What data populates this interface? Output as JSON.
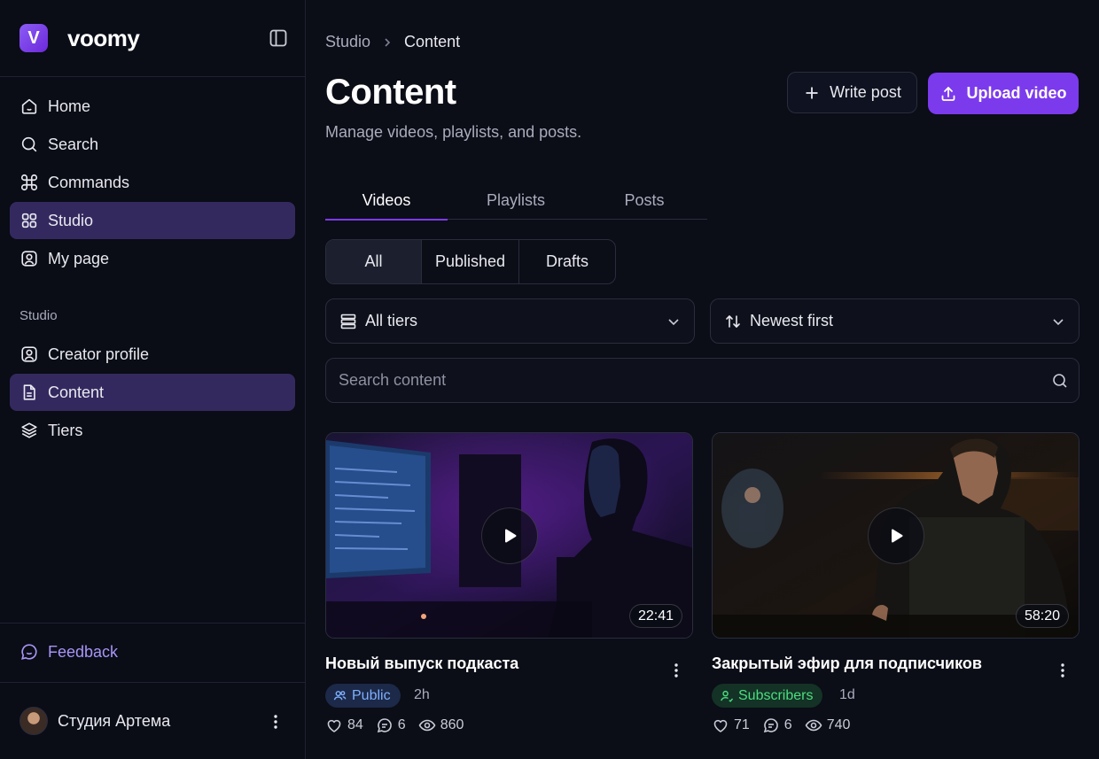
{
  "brand": {
    "logo_letter": "V",
    "name": "voomy"
  },
  "sidebar": {
    "nav": [
      {
        "label": "Home",
        "icon": "home-icon"
      },
      {
        "label": "Search",
        "icon": "search-icon"
      },
      {
        "label": "Commands",
        "icon": "command-icon"
      },
      {
        "label": "Studio",
        "icon": "grid-icon",
        "active": true
      },
      {
        "label": "My page",
        "icon": "user-square-icon"
      }
    ],
    "section_label": "Studio",
    "studio_nav": [
      {
        "label": "Creator profile",
        "icon": "user-square-icon"
      },
      {
        "label": "Content",
        "icon": "file-icon",
        "active": true
      },
      {
        "label": "Tiers",
        "icon": "layers-icon"
      }
    ],
    "feedback": "Feedback",
    "profile_name": "Студия Артема"
  },
  "breadcrumb": {
    "parent": "Studio",
    "current": "Content"
  },
  "header": {
    "title": "Content",
    "subtitle": "Manage videos, playlists, and posts.",
    "write_post": "Write post",
    "upload_video": "Upload video"
  },
  "tabs": [
    {
      "label": "Videos",
      "active": true
    },
    {
      "label": "Playlists"
    },
    {
      "label": "Posts"
    }
  ],
  "filters": {
    "status": [
      {
        "label": "All",
        "active": true
      },
      {
        "label": "Published"
      },
      {
        "label": "Drafts"
      }
    ],
    "tier_select": "All tiers",
    "sort_select": "Newest first",
    "search_placeholder": "Search content"
  },
  "videos": [
    {
      "title": "Новый выпуск подкаста",
      "duration": "22:41",
      "visibility": "Public",
      "age": "2h",
      "likes": "84",
      "comments": "6",
      "views": "860"
    },
    {
      "title": "Закрытый эфир для подписчиков",
      "duration": "58:20",
      "visibility": "Subscribers",
      "age": "1d",
      "likes": "71",
      "comments": "6",
      "views": "740"
    }
  ],
  "colors": {
    "accent": "#7c3aed",
    "active_nav": "#34295f",
    "feedback": "#a795f7",
    "public_badge": "#7fb0ff",
    "subscribers_badge": "#4ade80"
  }
}
